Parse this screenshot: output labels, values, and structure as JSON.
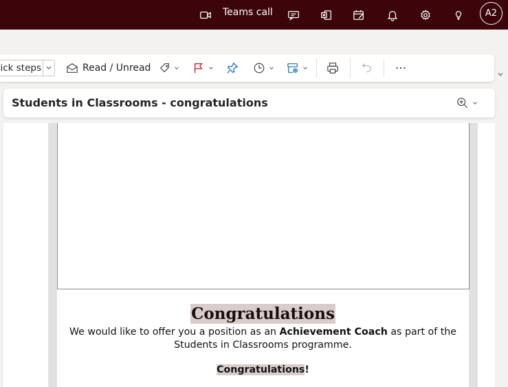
{
  "header": {
    "teams_call_label": "Teams call",
    "avatar_initials": "A2",
    "icons": [
      "video-icon",
      "chat-icon",
      "excel-icon",
      "calendar-check-icon",
      "bell-icon",
      "gear-icon",
      "lightbulb-icon"
    ]
  },
  "toolbar": {
    "quick_steps_label": "Quick steps",
    "read_unread_label": "Read / Unread",
    "icons": [
      "envelope-open-icon",
      "tag-icon",
      "flag-icon",
      "pin-icon",
      "clock-icon",
      "rules-icon",
      "print-icon",
      "undo-icon",
      "more-icon"
    ]
  },
  "message": {
    "subject": "Students in Classrooms - congratulations",
    "heading": "Congratulations",
    "body_before": "We would like to offer you a position as an ",
    "body_bold": "Achievement Coach",
    "body_after": " as part of the Students in Classrooms programme.",
    "closing": "Congratulations",
    "closing_punct": "!"
  },
  "colors": {
    "header_bg": "#3b0509",
    "highlight": "#d9cccc",
    "flag_red": "#c50f1f",
    "accent_blue": "#0f6cbd"
  }
}
